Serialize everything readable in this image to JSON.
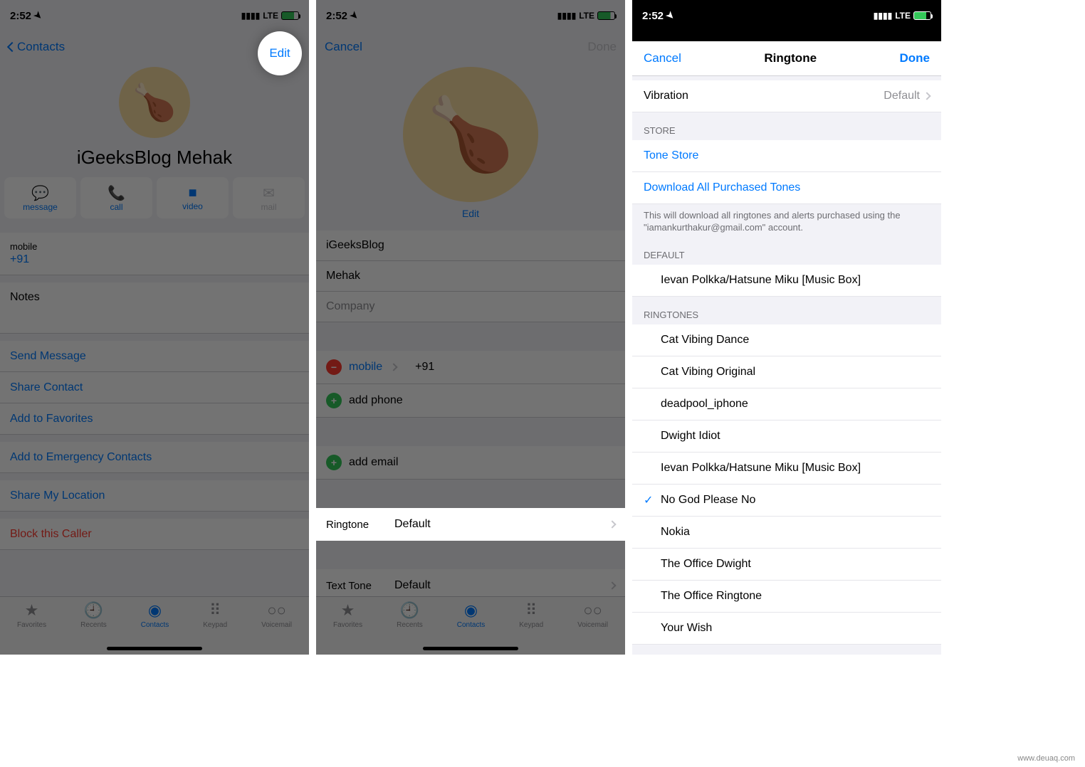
{
  "status": {
    "time": "2:52",
    "carrier": "LTE"
  },
  "panel1": {
    "nav_back": "Contacts",
    "nav_edit": "Edit",
    "contact_name": "iGeeksBlog Mehak",
    "actions": {
      "message": "message",
      "call": "call",
      "video": "video",
      "mail": "mail"
    },
    "phone_label": "mobile",
    "phone_value": "+91",
    "notes_label": "Notes",
    "links": {
      "send_message": "Send Message",
      "share_contact": "Share Contact",
      "add_favorites": "Add to Favorites",
      "add_emergency": "Add to Emergency Contacts",
      "share_location": "Share My Location",
      "block": "Block this Caller"
    },
    "tabs": {
      "favorites": "Favorites",
      "recents": "Recents",
      "contacts": "Contacts",
      "keypad": "Keypad",
      "voicemail": "Voicemail"
    }
  },
  "panel2": {
    "nav_cancel": "Cancel",
    "nav_done": "Done",
    "edit_photo": "Edit",
    "first_name": "iGeeksBlog",
    "last_name": "Mehak",
    "company_ph": "Company",
    "mobile_label": "mobile",
    "mobile_value": "+91",
    "add_phone": "add phone",
    "add_email": "add email",
    "ringtone_label": "Ringtone",
    "ringtone_value": "Default",
    "texttone_label": "Text Tone",
    "texttone_value": "Default"
  },
  "panel3": {
    "nav_cancel": "Cancel",
    "nav_title": "Ringtone",
    "nav_done": "Done",
    "vibration_label": "Vibration",
    "vibration_value": "Default",
    "store_header": "STORE",
    "tone_store": "Tone Store",
    "download_all": "Download All Purchased Tones",
    "store_footer": "This will download all ringtones and alerts purchased using the \"iamankurthakur@gmail.com\" account.",
    "default_header": "DEFAULT",
    "default_tone": "Ievan Polkka/Hatsune Miku [Music Box]",
    "ringtones_header": "RINGTONES",
    "ringtones": [
      "Cat Vibing Dance",
      "Cat Vibing Original",
      "deadpool_iphone",
      "Dwight Idiot",
      "Ievan Polkka/Hatsune Miku [Music Box]",
      "No God Please No",
      "Nokia",
      "The Office Dwight",
      "The Office Ringtone",
      "Your Wish"
    ],
    "selected_index": 5
  },
  "watermark": "www.deuaq.com"
}
